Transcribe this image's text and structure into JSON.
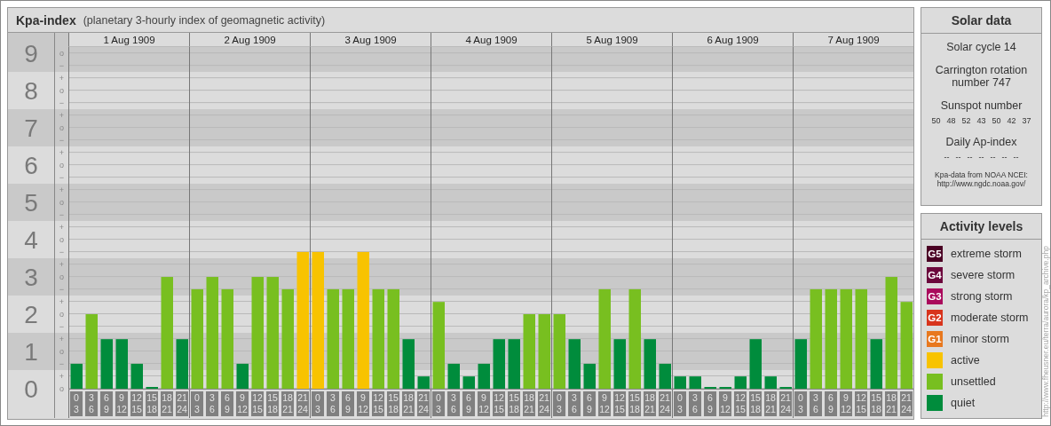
{
  "kpa_panel": {
    "title": "Kpa-index",
    "subtitle": "(planetary 3-hourly index of geomagnetic activity)",
    "days": [
      "1 Aug 1909",
      "2 Aug 1909",
      "3 Aug 1909",
      "4 Aug 1909",
      "5 Aug 1909",
      "6 Aug 1909",
      "7 Aug 1909"
    ],
    "minor_ticks": [
      "o",
      "−",
      "+",
      "o",
      "−",
      "+",
      "o",
      "−",
      "+",
      "o",
      "−",
      "+",
      "o",
      "−",
      "+",
      "o",
      "−",
      "+",
      "o",
      "−",
      "+",
      "o",
      "−",
      "+",
      "o",
      "−",
      "+",
      "o"
    ],
    "chart_data": {
      "type": "bar",
      "grid": true,
      "ylim": [
        0,
        9.17
      ],
      "yticks": [
        0,
        1,
        2,
        3,
        4,
        5,
        6,
        7,
        8,
        9
      ],
      "categories": [
        "0 3",
        "3 6",
        "6 9",
        "9 12",
        "12 15",
        "15 18",
        "18 21",
        "21 24",
        "0 3",
        "3 6",
        "6 9",
        "9 12",
        "12 15",
        "15 18",
        "18 21",
        "21 24",
        "0 3",
        "3 6",
        "6 9",
        "9 12",
        "12 15",
        "15 18",
        "18 21",
        "21 24",
        "0 3",
        "3 6",
        "6 9",
        "9 12",
        "12 15",
        "15 18",
        "18 21",
        "21 24",
        "0 3",
        "3 6",
        "6 9",
        "9 12",
        "12 15",
        "15 18",
        "18 21",
        "21 24",
        "0 3",
        "3 6",
        "6 9",
        "9 12",
        "12 15",
        "15 18",
        "18 21",
        "21 24",
        "0 3",
        "3 6",
        "6 9",
        "9 12",
        "12 15",
        "15 18",
        "18 21",
        "21 24"
      ],
      "series": [
        {
          "values": [
            0.67,
            2,
            1.33,
            1.33,
            0.67,
            0,
            3,
            1.33,
            2.67,
            3,
            2.67,
            0.67,
            3,
            3,
            2.67,
            3.67,
            3.67,
            2.67,
            2.67,
            3.67,
            2.67,
            2.67,
            1.33,
            0.33,
            2.33,
            0.67,
            0.33,
            0.67,
            1.33,
            1.33,
            2,
            2,
            2,
            1.33,
            0.67,
            2.67,
            1.33,
            2.67,
            1.33,
            0.67,
            0.33,
            0.33,
            0,
            0,
            0.33,
            1.33,
            0.33,
            0,
            1.33,
            2.67,
            2.67,
            2.67,
            2.67,
            1.33,
            3,
            2.33
          ]
        }
      ]
    }
  },
  "solar_data": {
    "title": "Solar data",
    "solar_cycle": "Solar cycle 14",
    "carrington": "Carrington rotation number 747",
    "sunspot_title": "Sunspot number",
    "sunspot_numbers": [
      "50",
      "48",
      "52",
      "43",
      "50",
      "42",
      "37"
    ],
    "ap_title": "Daily Ap-index",
    "ap_values": [
      "--",
      "--",
      "--",
      "--",
      "--",
      "--",
      "--"
    ],
    "source": "Kpa-data from NOAA NCEI: http://www.ngdc.noaa.gov/"
  },
  "activity_levels": {
    "title": "Activity levels",
    "items": [
      {
        "badge": "G5",
        "label": "extreme storm",
        "color": "#4a0024"
      },
      {
        "badge": "G4",
        "label": "severe storm",
        "color": "#6c083c"
      },
      {
        "badge": "G3",
        "label": "strong storm",
        "color": "#aa0a5c"
      },
      {
        "badge": "G2",
        "label": "moderate storm",
        "color": "#d8341c"
      },
      {
        "badge": "G1",
        "label": "minor storm",
        "color": "#e8781e"
      },
      {
        "label": "active",
        "color": "#f8c300"
      },
      {
        "label": "unsettled",
        "color": "#78bf20"
      },
      {
        "label": "quiet",
        "color": "#008c3c"
      }
    ]
  },
  "credit": "http://www.fheusner.eu/terra/aurora/kp_archive.php"
}
